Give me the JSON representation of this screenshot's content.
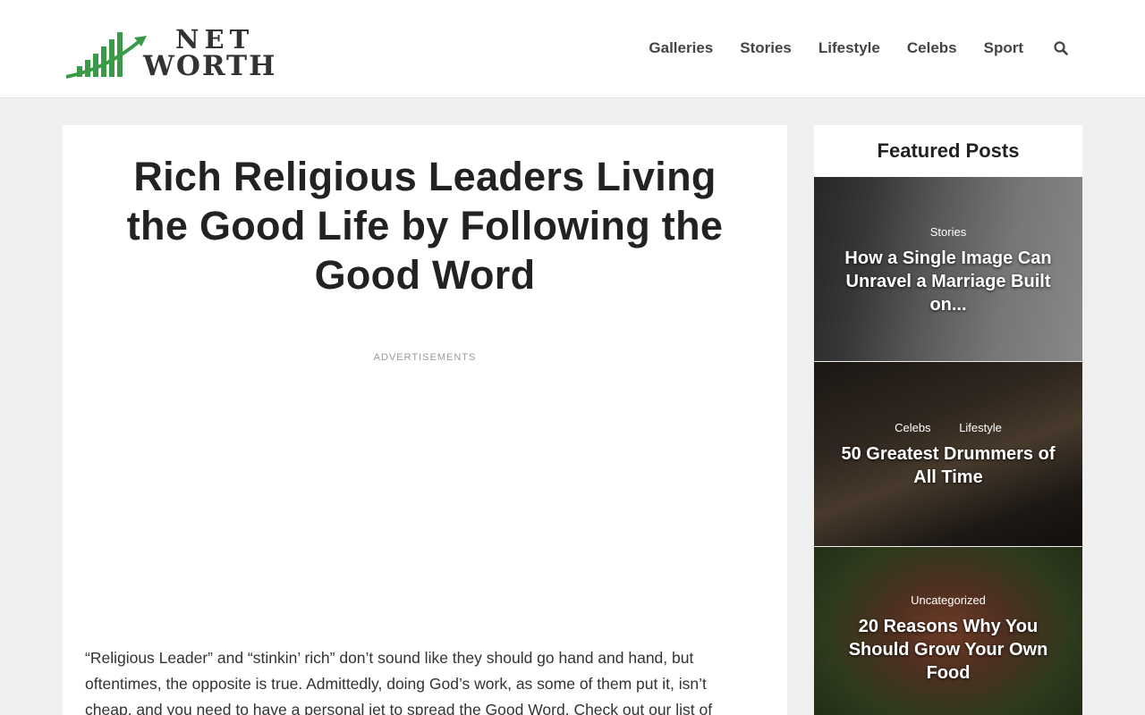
{
  "site": {
    "logo_line1": "NET",
    "logo_line2": "WORTH",
    "logo_green": "#3a9a48"
  },
  "nav": {
    "items": [
      "Galleries",
      "Stories",
      "Lifestyle",
      "Celebs",
      "Sport"
    ],
    "search_icon": "search-icon"
  },
  "article": {
    "title": "Rich Religious Leaders Living the Good Life by Following the Good Word",
    "ad_label": "ADVERTISEMENTS",
    "intro": "“Religious Leader” and “stinkin’ rich” don’t sound like they should go hand and hand, but oftentimes, the opposite is true. Admittedly, doing God’s work, as some of them put it, isn’t cheap, and you need to have a personal jet to spread the Good Word. Check out our list of"
  },
  "sidebar": {
    "heading": "Featured Posts",
    "posts": [
      {
        "categories": [
          "Stories"
        ],
        "title": "How a Single Image Can Unravel a Marriage Built on..."
      },
      {
        "categories": [
          "Celebs",
          "Lifestyle"
        ],
        "title": "50 Greatest Drummers of All Time"
      },
      {
        "categories": [
          "Uncategorized"
        ],
        "title": "20 Reasons Why You Should Grow Your Own Food"
      }
    ]
  }
}
